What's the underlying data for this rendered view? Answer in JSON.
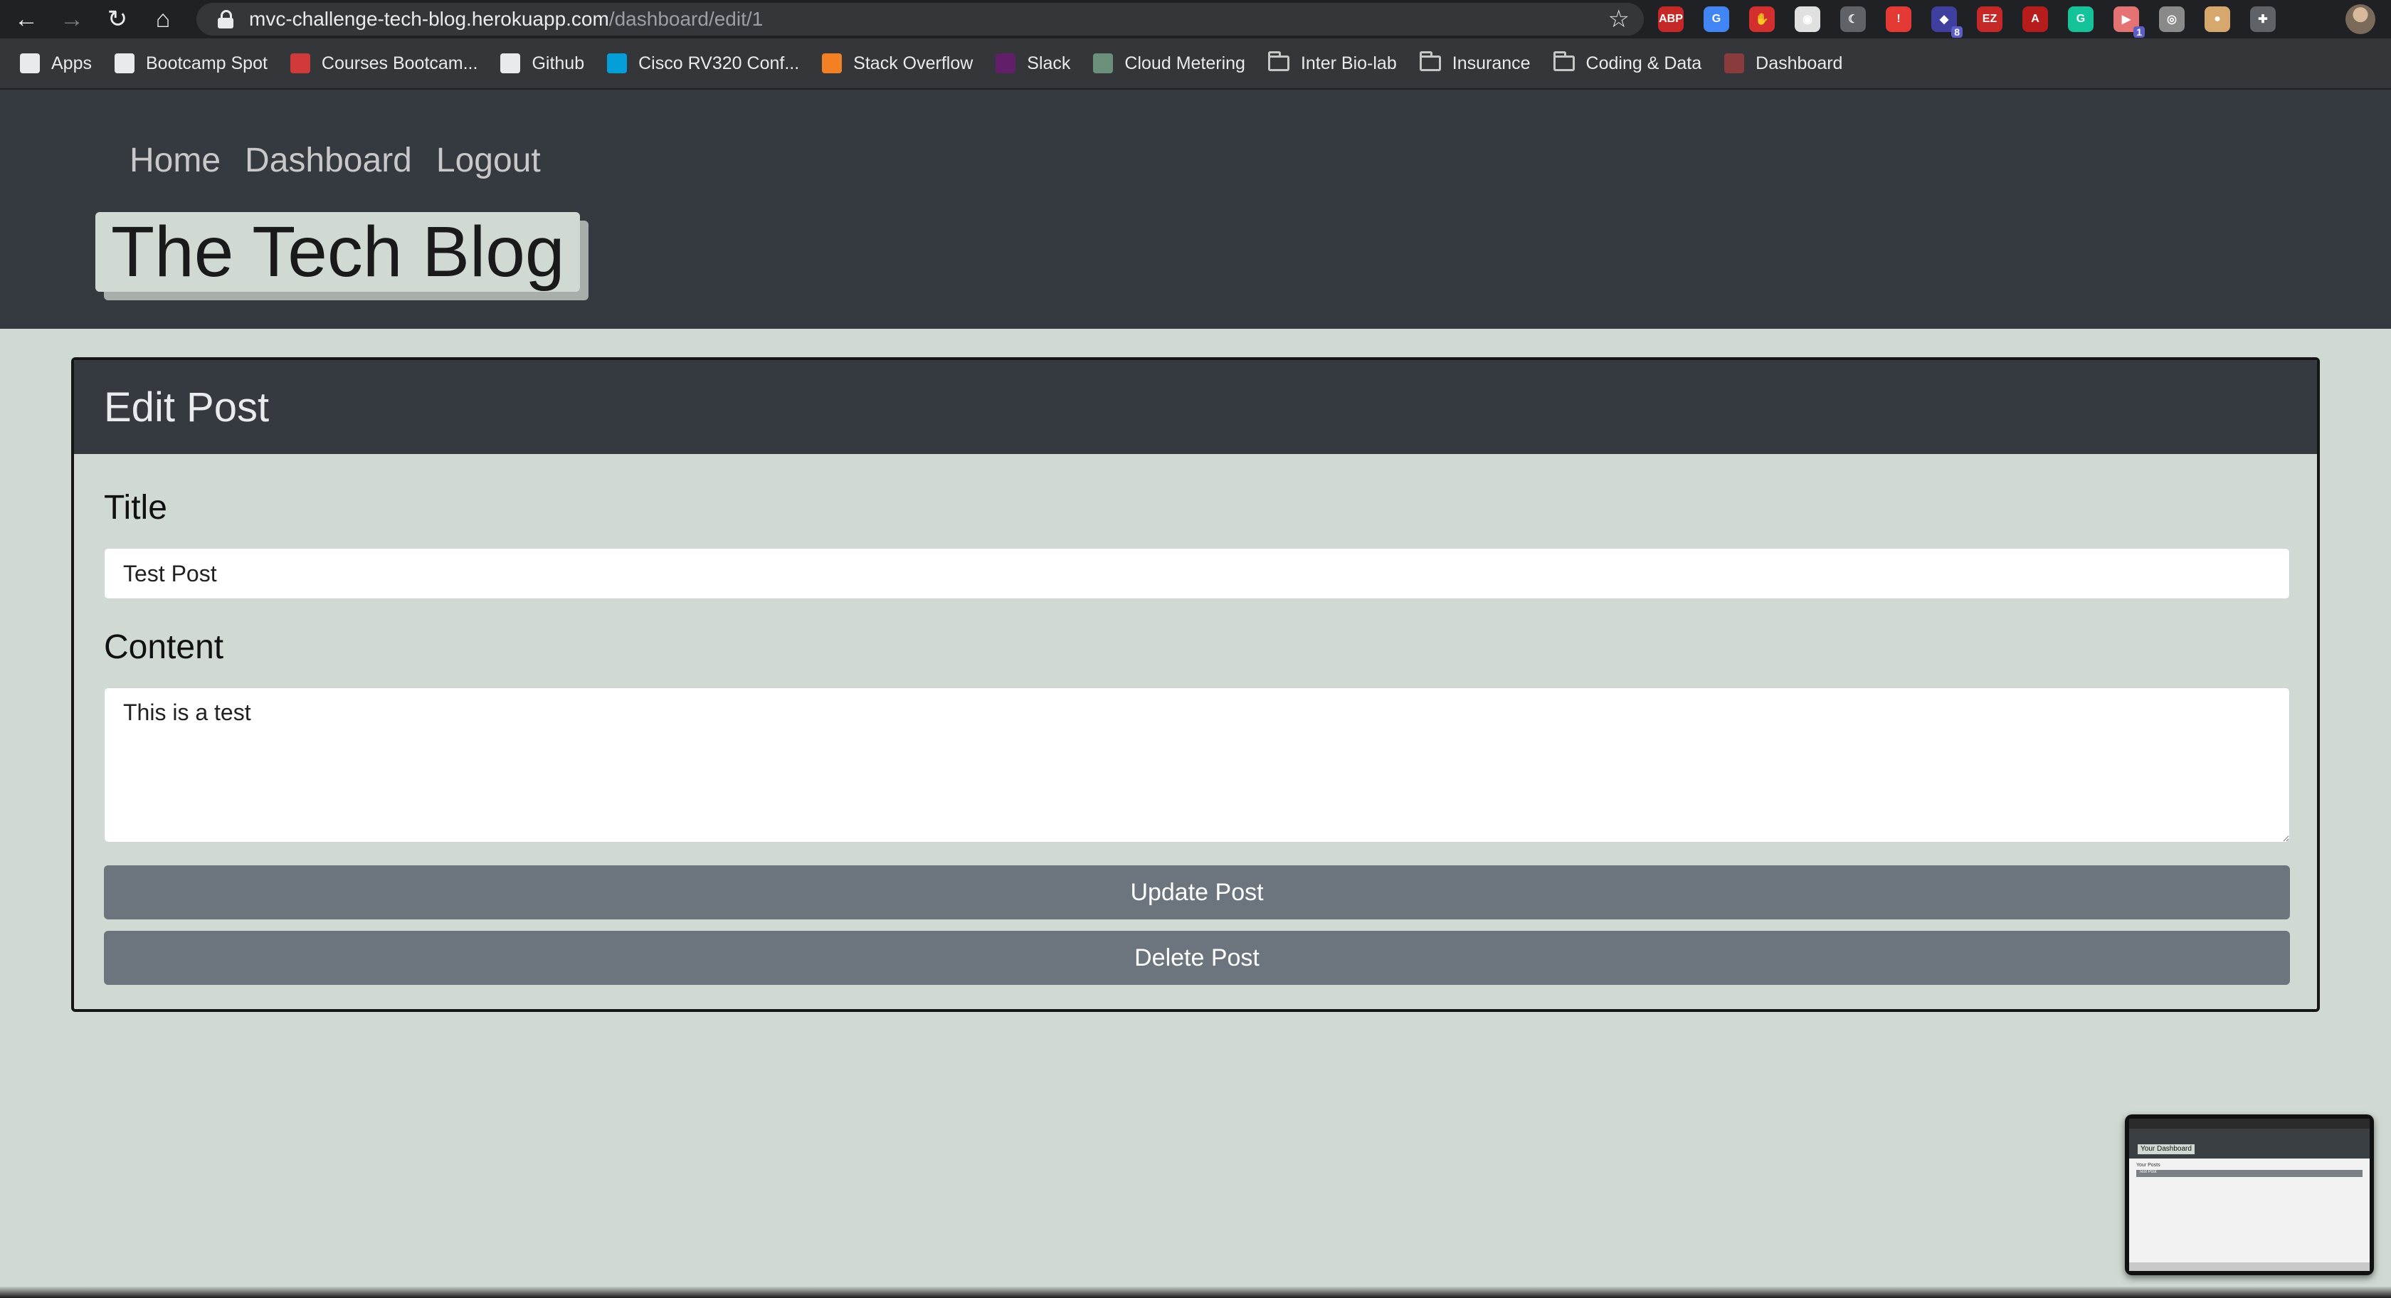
{
  "browser": {
    "url_host": "mvc-challenge-tech-blog.herokuapp.com",
    "url_path": "/dashboard/edit/1",
    "extensions": [
      {
        "name": "adblock-icon",
        "label": "ABP",
        "color": "#c62828"
      },
      {
        "name": "translate-icon",
        "label": "G",
        "color": "#4285f4"
      },
      {
        "name": "stop-hand-icon",
        "label": "✋",
        "color": "#d32f2f"
      },
      {
        "name": "circle-extension-icon",
        "label": "◉",
        "color": "#e0e0e0"
      },
      {
        "name": "moon-extension-icon",
        "label": "☾",
        "color": "#5f6368"
      },
      {
        "name": "alert-extension-icon",
        "label": "!",
        "color": "#e53935"
      },
      {
        "name": "extension-badge-8-icon",
        "label": "◆",
        "color": "#3f3fa0",
        "badge": "8"
      },
      {
        "name": "ez-extension-icon",
        "label": "EZ",
        "color": "#c62828"
      },
      {
        "name": "pdf-icon",
        "label": "A",
        "color": "#b71c1c"
      },
      {
        "name": "grammarly-icon",
        "label": "G",
        "color": "#15c39a"
      },
      {
        "name": "cast-extension-icon",
        "label": "▶",
        "color": "#e57373",
        "badge": "1"
      },
      {
        "name": "camera-icon",
        "label": "◎",
        "color": "#8a8a8a"
      },
      {
        "name": "cookie-icon",
        "label": "●",
        "color": "#d7a86e"
      },
      {
        "name": "puzzle-icon",
        "label": "✚",
        "color": "#5f6368"
      }
    ]
  },
  "bookmarks": [
    {
      "label": "Apps",
      "icon": "apps-grid-icon",
      "color": "#e8eaed",
      "folder": false
    },
    {
      "label": "Bootcamp Spot",
      "icon": "bootcamp-spot-icon",
      "color": "#e8eaed",
      "folder": false
    },
    {
      "label": "Courses Bootcam...",
      "icon": "courses-icon",
      "color": "#d13a3a",
      "folder": false
    },
    {
      "label": "Github",
      "icon": "github-icon",
      "color": "#e8eaed",
      "folder": false
    },
    {
      "label": "Cisco RV320 Conf...",
      "icon": "cisco-icon",
      "color": "#049fd9",
      "folder": false
    },
    {
      "label": "Stack Overflow",
      "icon": "stack-overflow-icon",
      "color": "#f48024",
      "folder": false
    },
    {
      "label": "Slack",
      "icon": "slack-icon",
      "color": "#611f69",
      "folder": false
    },
    {
      "label": "Cloud Metering",
      "icon": "cloud-metering-icon",
      "color": "#6a8f7a",
      "folder": false
    },
    {
      "label": "Inter Bio-lab",
      "icon": "folder-icon",
      "color": "#c4c7c5",
      "folder": true
    },
    {
      "label": "Insurance",
      "icon": "folder-icon",
      "color": "#c4c7c5",
      "folder": true
    },
    {
      "label": "Coding & Data",
      "icon": "folder-icon",
      "color": "#c4c7c5",
      "folder": true
    },
    {
      "label": "Dashboard",
      "icon": "dashboard-icon",
      "color": "#8a3b3b",
      "folder": false
    }
  ],
  "site": {
    "nav": [
      "Home",
      "Dashboard",
      "Logout"
    ],
    "brand": "The Tech Blog"
  },
  "edit_post": {
    "heading": "Edit Post",
    "title_label": "Title",
    "title_value": "Test Post",
    "content_label": "Content",
    "content_value": "This is a test",
    "update_button": "Update Post",
    "delete_button": "Delete Post"
  },
  "thumbnail": {
    "brand": "Your Dashboard",
    "subheading": "Your Posts",
    "row": "Test Post"
  },
  "colors": {
    "page_bg": "#d0dad2",
    "header_bg": "#343a40",
    "button_bg": "#6c757d"
  }
}
